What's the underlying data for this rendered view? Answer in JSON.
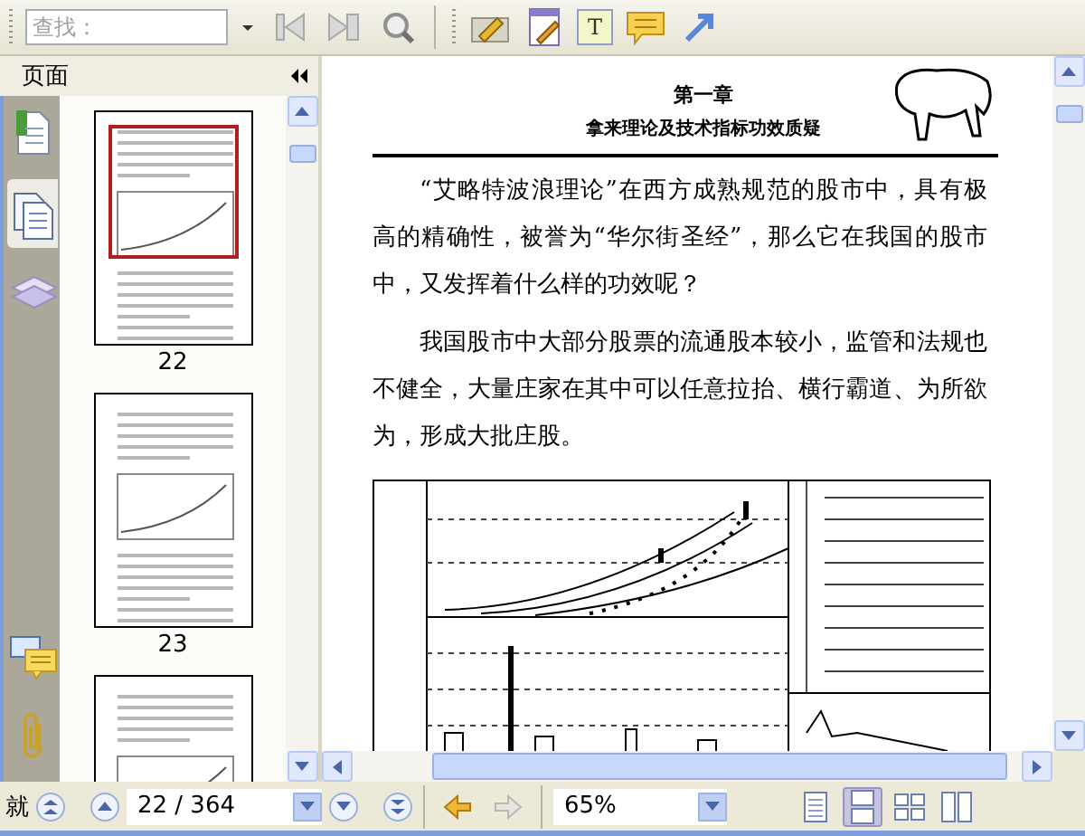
{
  "toolbar": {
    "search": {
      "placeholder": "查找："
    },
    "text_tool_label": "T"
  },
  "side_panel": {
    "title": "页面",
    "tabs": [
      {
        "kind": "bookmarks",
        "selected": false
      },
      {
        "kind": "pages",
        "selected": true
      },
      {
        "kind": "layers",
        "selected": false
      }
    ],
    "bottom_tabs": [
      {
        "kind": "comments",
        "selected": false
      },
      {
        "kind": "attachments",
        "selected": false
      }
    ],
    "thumbnails": [
      {
        "label": "22",
        "selected": true
      },
      {
        "label": "23",
        "selected": false
      },
      {
        "selected": false
      }
    ]
  },
  "document": {
    "chapter": "第一章",
    "chapter_title": "拿来理论及技术指标功效质疑",
    "paragraphs": [
      {
        "lines": [
          "“艾略特波浪理论”在西方成熟规范的股市中，具有极",
          "高的精确性，被誉为“华尔街圣经”，那么它在我国的股市",
          "中，又发挥着什么样的功效呢？"
        ]
      },
      {
        "lines": [
          "我国股市中大部分股票的流通股本较小，监管和法规也",
          "不健全，大量庄家在其中可以任意拉抬、横行霸道、为所欲",
          "为，形成大批庄股。"
        ]
      }
    ]
  },
  "status_bar": {
    "cut_label": "就",
    "page": "22 / 364",
    "zoom": "65%",
    "forward_disabled": true,
    "view_modes": [
      {
        "kind": "single",
        "selected": false
      },
      {
        "kind": "continuous",
        "selected": true
      },
      {
        "kind": "facing",
        "selected": false
      },
      {
        "kind": "continuous_facing",
        "selected": false
      }
    ]
  }
}
